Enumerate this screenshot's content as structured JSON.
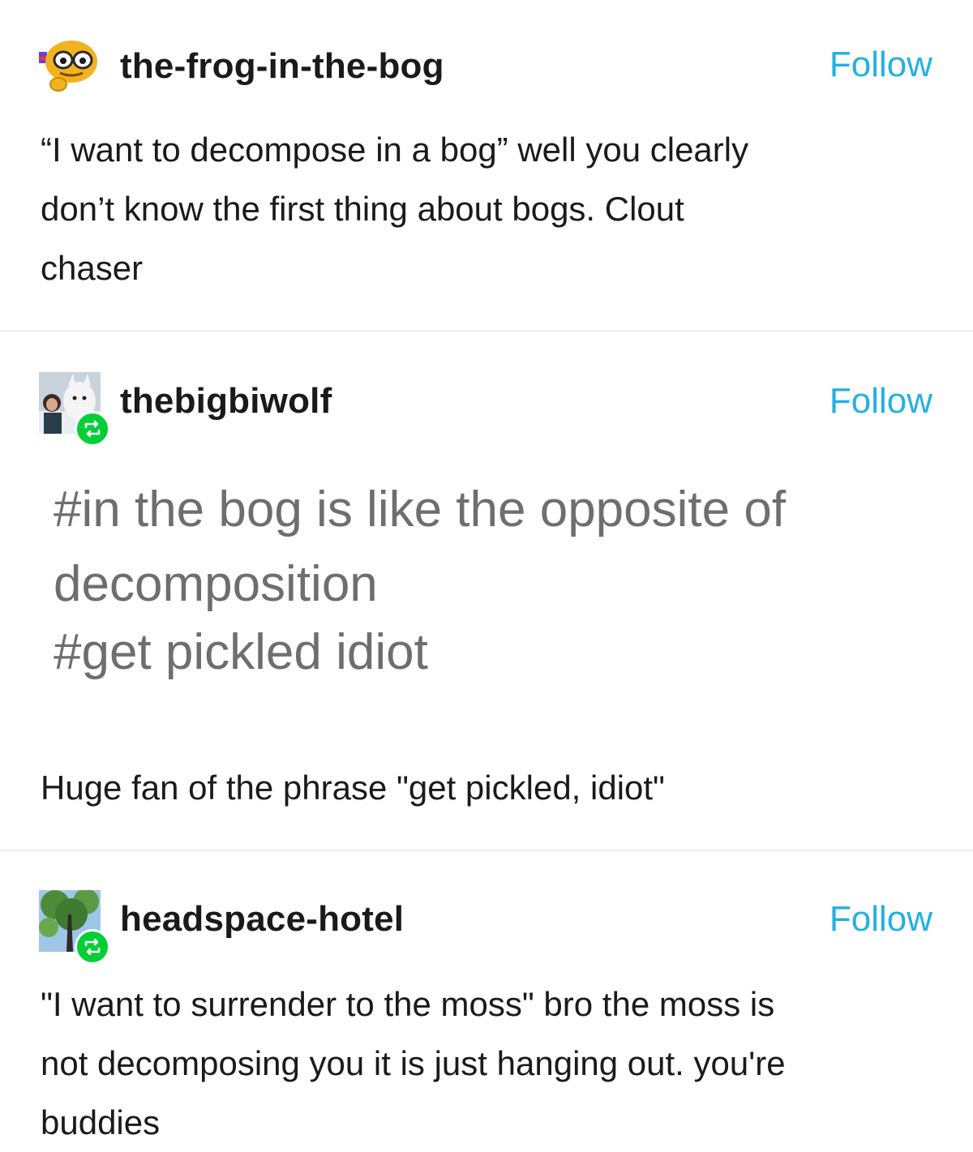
{
  "posts": [
    {
      "username": "the-frog-in-the-bog",
      "follow_label": "Follow",
      "avatar_icon": "frog-avatar-icon",
      "body_lines": [
        "“I want to decompose in a bog” well you clearly",
        "don’t know the first thing about bogs. Clout",
        "chaser"
      ]
    },
    {
      "username": "thebigbiwolf",
      "follow_label": "Follow",
      "avatar_icon": "wolf-avatar-icon",
      "tags": [
        "#in the bog is like the opposite of",
        "decomposition",
        "#get pickled idiot"
      ],
      "body_lines": [
        "Huge fan of the phrase \"get pickled, idiot\""
      ]
    },
    {
      "username": "headspace-hotel",
      "follow_label": "Follow",
      "avatar_icon": "tree-avatar-icon",
      "body_lines": [
        "\"I want to surrender to the moss\" bro the moss is",
        "not decomposing you it is just hanging out. you're",
        "buddies"
      ]
    }
  ],
  "colors": {
    "follow": "#23b0e3",
    "tag_text": "#6e6e6e",
    "reblog_badge": "#00cf35"
  }
}
